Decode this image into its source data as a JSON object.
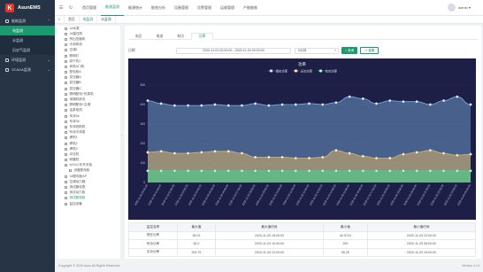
{
  "app": {
    "name": "AsunEMS",
    "logo_letter": "K"
  },
  "sidebar": {
    "items": [
      {
        "label": "能耗监测",
        "active": false,
        "section": true
      },
      {
        "label": "电监测",
        "active": true,
        "sub": true
      },
      {
        "label": "水监测",
        "active": false,
        "sub": true
      },
      {
        "label": "历史气监测",
        "active": false,
        "sub": true
      },
      {
        "label": "环境监测",
        "active": false,
        "section": true
      },
      {
        "label": "SCADA监测",
        "active": false,
        "section": true
      }
    ]
  },
  "topnav": {
    "items": [
      "首页管理",
      "能源监测",
      "能源统计",
      "能效分析",
      "设备管理",
      "告警管理",
      "运维管理",
      "产能能耗"
    ],
    "active_index": 1
  },
  "user": {
    "name": "admin"
  },
  "tabsbar": {
    "items": [
      "首页",
      "电监测",
      "水监测"
    ],
    "active_index": 1
  },
  "tree": {
    "items": [
      {
        "label": "1#水泵"
      },
      {
        "label": "2#高压机"
      },
      {
        "label": "挤出压缩机"
      },
      {
        "label": "冷却风机"
      },
      {
        "label": "空调1"
      },
      {
        "label": "照明灯"
      },
      {
        "label": "烘干机1"
      },
      {
        "label": "风机A门机"
      },
      {
        "label": "配电柜A"
      },
      {
        "label": "变压器A"
      },
      {
        "label": "变压器B"
      },
      {
        "label": "变压器C"
      },
      {
        "label": "照明配电+热泵机"
      },
      {
        "label": "电梯机房总"
      },
      {
        "label": "照明配电+空调"
      },
      {
        "label": "油泵电机"
      },
      {
        "label": "车床2#"
      },
      {
        "label": "车床3#"
      },
      {
        "label": "车床铣削机"
      },
      {
        "label": "车床冷却泵"
      },
      {
        "label": "焊机1"
      },
      {
        "label": "焊机2"
      },
      {
        "label": "焊机3"
      },
      {
        "label": "冲压机"
      },
      {
        "label": "研磨机"
      },
      {
        "label": "AGV小车开关柜"
      },
      {
        "label": "设备配电柜",
        "indent": true
      },
      {
        "label": "1#配电柜AP"
      },
      {
        "label": "空调动力箱"
      },
      {
        "label": "测试箱电表"
      },
      {
        "label": "测试动力柜"
      },
      {
        "label": "测试配电柜",
        "highlight": true
      },
      {
        "label": "监控设备"
      }
    ]
  },
  "subtabs": {
    "items": [
      "电压",
      "电流",
      "有功",
      "功率"
    ],
    "active_index": 3
  },
  "filter": {
    "label": "日期",
    "date_range": "2020-11-03 00:00:00  -  2020-11-04 00:00:00",
    "interval": "5分钟",
    "search_label": "查询",
    "reset_label": "重置"
  },
  "chart_data": {
    "type": "area",
    "title": "功率",
    "legend_position": "top-center",
    "ylim": [
      0,
      500
    ],
    "yticks": [
      0,
      100,
      200,
      300,
      400,
      500
    ],
    "x": [
      "2020-11-03 00:00:00",
      "2020-11-03 01:00:00",
      "2020-11-03 02:00:00",
      "2020-11-03 03:00:00",
      "2020-11-03 04:00:00",
      "2020-11-03 05:00:00",
      "2020-11-03 06:00:00",
      "2020-11-03 07:00:00",
      "2020-11-03 08:00:00",
      "2020-11-03 09:00:00",
      "2020-11-03 10:00:00",
      "2020-11-03 11:00:00",
      "2020-11-03 12:00:00",
      "2020-11-03 13:00:00",
      "2020-11-03 14:00:00",
      "2020-11-03 15:00:00",
      "2020-11-03 16:00:00",
      "2020-11-03 17:00:00",
      "2020-11-03 18:00:00",
      "2020-11-03 19:00:00",
      "2020-11-03 20:00:00",
      "2020-11-03 21:00:00",
      "2020-11-03 22:00:00",
      "2020-11-03 23:00:00",
      "2020-11-04 00:00:00"
    ],
    "series": [
      {
        "name": "视在功率",
        "color": "#7fb0e0",
        "values": [
          420,
          405,
          395,
          395,
          395,
          400,
          395,
          395,
          405,
          395,
          400,
          400,
          405,
          400,
          410,
          440,
          430,
          405,
          420,
          415,
          415,
          400,
          420,
          440,
          400
        ]
      },
      {
        "name": "无功功率",
        "color": "#d8b56a",
        "values": [
          155,
          160,
          150,
          150,
          155,
          160,
          160,
          150,
          130,
          130,
          130,
          125,
          125,
          130,
          165,
          150,
          135,
          125,
          125,
          145,
          155,
          165,
          150,
          140,
          145
        ]
      },
      {
        "name": "有功功率",
        "color": "#3ed68e",
        "values": [
          60,
          60,
          60,
          60,
          60,
          60,
          60,
          60,
          60,
          60,
          60,
          60,
          60,
          60,
          60,
          60,
          60,
          60,
          60,
          60,
          60,
          60,
          60,
          60,
          60
        ]
      }
    ]
  },
  "stats_table": {
    "headers": [
      "监控名称",
      "最大值",
      "最大值时间",
      "最小值",
      "最小值时间"
    ],
    "rows": [
      [
        "视在功率",
        "35.03",
        "2020-11-03 15:00:00",
        "40.0723",
        "2020-11-03 22:00:00"
      ],
      [
        "有功功率",
        "30.2",
        "2020-11-03 10:00:00",
        "200",
        "2020-11-03 08:00:00"
      ],
      [
        "无功功率",
        "209.75",
        "2020-11-03 12:00:00",
        "95.25",
        "2020-11-03 15:00:00"
      ]
    ]
  },
  "footer": {
    "copyright": "Copyright © 2020 Asun All Rights Reserved",
    "version": "Version v1.0"
  }
}
